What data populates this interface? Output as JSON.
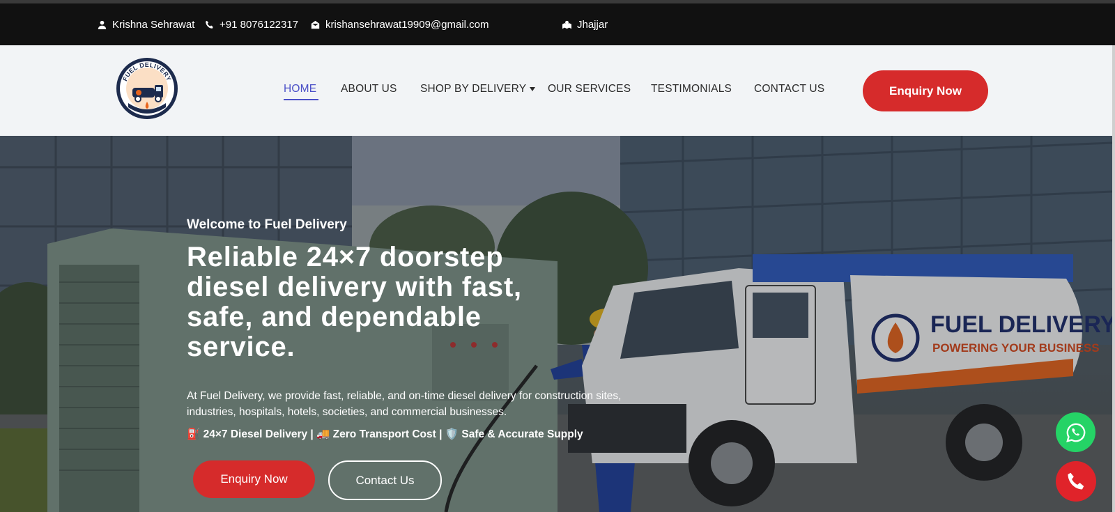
{
  "topbar": {
    "name": "Krishna Sehrawat",
    "phone": "+91 8076122317",
    "email": "krishansehrawat19909@gmail.com",
    "location": "Jhajjar"
  },
  "nav": {
    "items": [
      "HOME",
      "ABOUT US",
      "SHOP BY DELIVERY",
      "OUR SERVICES",
      "TESTIMONIALS",
      "CONTACT US"
    ],
    "enquiry_label": "Enquiry Now",
    "accent_color": "#4a4fc7"
  },
  "logo": {
    "text_top": "FUEL DELIVERY"
  },
  "hero": {
    "welcome": "Welcome to Fuel Delivery",
    "headline": "Reliable 24×7 doorstep diesel delivery with fast, safe, and dependable service.",
    "description": "At Fuel Delivery, we provide fast, reliable, and on-time diesel delivery for construction sites, industries, hospitals, hotels, societies, and commercial businesses.",
    "features": "⛽ 24×7 Diesel Delivery | 🚚 Zero Transport Cost | 🛡️ Safe & Accurate Supply",
    "primary_button": "Enquiry Now",
    "secondary_button": "Contact Us",
    "truck_brand": "FUEL DELIVERY",
    "truck_tagline": "POWERING YOUR BUSINESS"
  },
  "colors": {
    "topbar_bg": "#111111",
    "header_bg": "#f2f4f6",
    "brand_red": "#d62b2b",
    "whatsapp_green": "#25d366"
  },
  "floating": {
    "whatsapp_icon": "whatsapp-icon",
    "call_icon": "phone-icon"
  }
}
